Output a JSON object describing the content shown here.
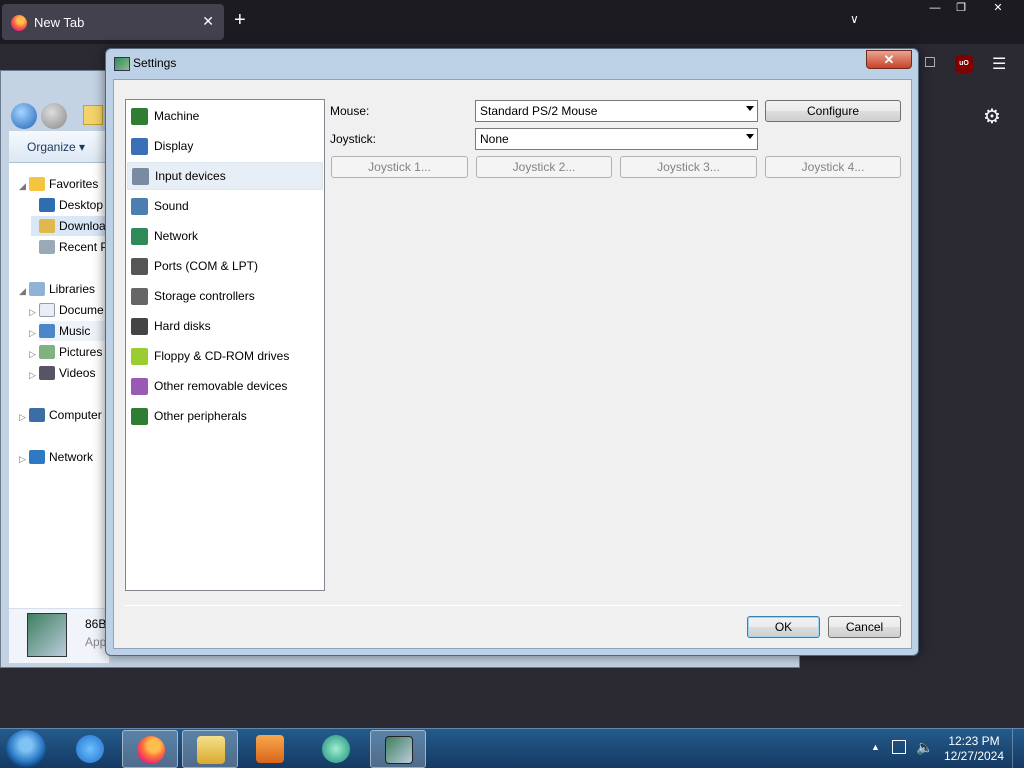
{
  "browser": {
    "tab_title": "New Tab",
    "new_tab_icon": "+",
    "tab_list_icon": "chevron-down",
    "ublock_label": "uO"
  },
  "explorer": {
    "organize_label": "Organize ▾",
    "tree": [
      {
        "label": "Favorites",
        "icon": "star-icon"
      },
      {
        "label": "Desktop",
        "icon": "desktop-icon"
      },
      {
        "label": "Downloa",
        "icon": "downloads-icon"
      },
      {
        "label": "Recent P",
        "icon": "recent-places-icon"
      },
      {
        "label": "Libraries",
        "icon": "libraries-icon"
      },
      {
        "label": "Docume",
        "icon": "documents-icon"
      },
      {
        "label": "Music",
        "icon": "music-icon"
      },
      {
        "label": "Pictures",
        "icon": "pictures-icon"
      },
      {
        "label": "Videos",
        "icon": "videos-icon"
      },
      {
        "label": "Computer",
        "icon": "computer-icon"
      },
      {
        "label": "Network",
        "icon": "network-icon"
      }
    ],
    "details_name": "86B",
    "details_type": "App"
  },
  "dialog": {
    "title": "Settings",
    "close_label": "✕",
    "categories": [
      {
        "label": "Machine",
        "icon": "machine-icon",
        "color": "#2e7d32"
      },
      {
        "label": "Display",
        "icon": "display-icon",
        "color": "#3b6fb6"
      },
      {
        "label": "Input devices",
        "icon": "input-devices-icon",
        "color": "#7a8aa0"
      },
      {
        "label": "Sound",
        "icon": "sound-icon",
        "color": "#4a7fb0"
      },
      {
        "label": "Network",
        "icon": "network-icon",
        "color": "#2e8b57"
      },
      {
        "label": "Ports (COM & LPT)",
        "icon": "ports-icon",
        "color": "#555555"
      },
      {
        "label": "Storage controllers",
        "icon": "storage-controllers-icon",
        "color": "#666666"
      },
      {
        "label": "Hard disks",
        "icon": "hard-disks-icon",
        "color": "#444444"
      },
      {
        "label": "Floppy & CD-ROM drives",
        "icon": "floppy-cdrom-icon",
        "color": "#9acd32"
      },
      {
        "label": "Other removable devices",
        "icon": "removable-devices-icon",
        "color": "#9b59b6"
      },
      {
        "label": "Other peripherals",
        "icon": "peripherals-icon",
        "color": "#2e7d32"
      }
    ],
    "selected_category": "Input devices",
    "mouse_label": "Mouse:",
    "mouse_value": "Standard PS/2 Mouse",
    "configure_label": "Configure",
    "joystick_label": "Joystick:",
    "joystick_value": "None",
    "joystick_buttons": [
      "Joystick 1...",
      "Joystick 2...",
      "Joystick 3...",
      "Joystick 4..."
    ],
    "ok_label": "OK",
    "cancel_label": "Cancel"
  },
  "taskbar": {
    "time": "12:23 PM",
    "date": "12/27/2024",
    "tray_expand": "▲"
  }
}
